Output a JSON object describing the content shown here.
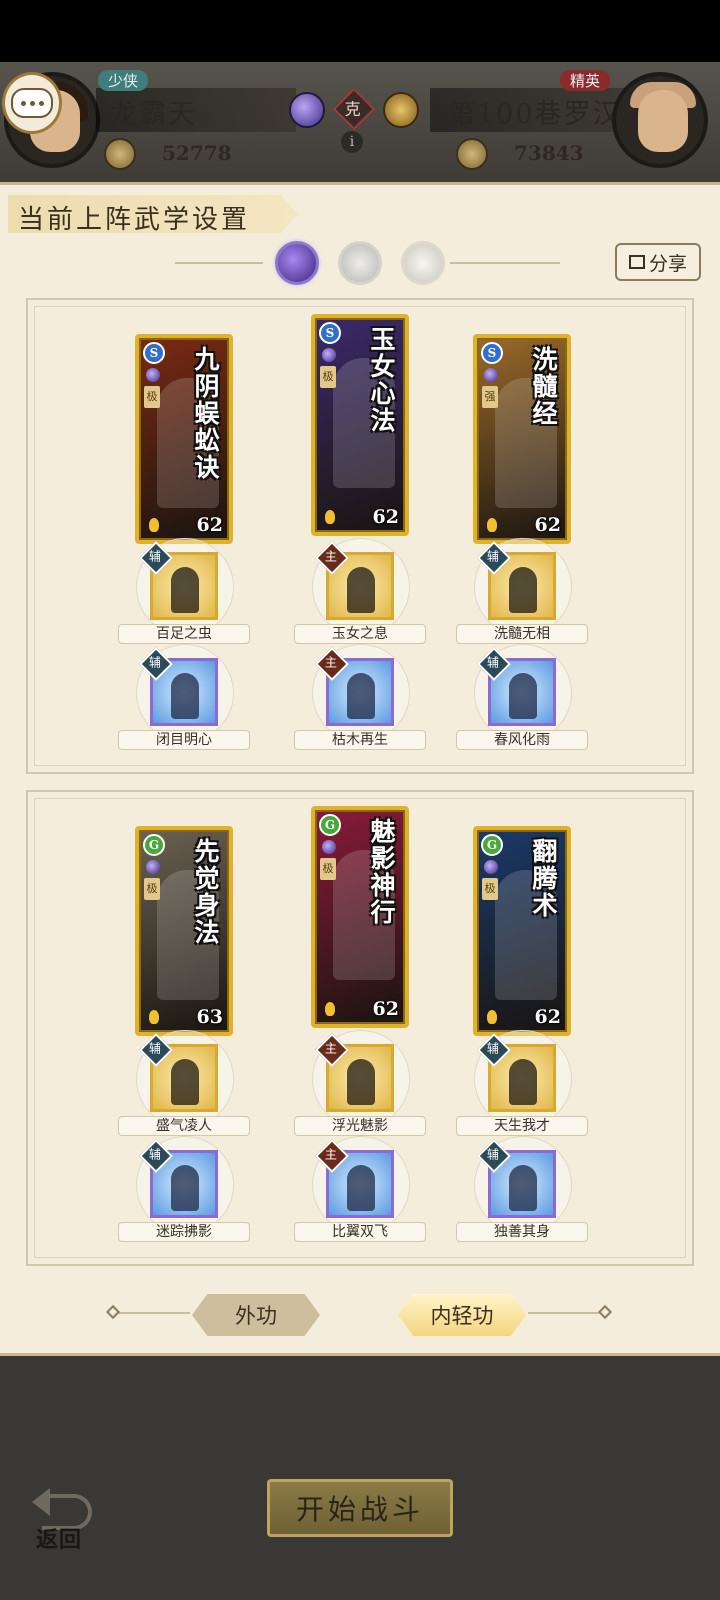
{
  "header": {
    "player": {
      "rank": "少侠",
      "name": "龙霸天",
      "power": "52778"
    },
    "opponent": {
      "rank": "精英",
      "name": "第100巷罗汉",
      "power": "73843"
    },
    "relation": "克",
    "info": "i"
  },
  "panel": {
    "title": "当前上阵武学设置",
    "share_label": "分享"
  },
  "inner_cards": [
    {
      "name": "九阴蜈蚣诀",
      "level": "62",
      "grade": "极",
      "type": "S",
      "bg": "#7a2a12"
    },
    {
      "name": "玉女心法",
      "level": "62",
      "grade": "极",
      "type": "S",
      "bg": "#3a2a6a"
    },
    {
      "name": "洗髓经",
      "level": "62",
      "grade": "强",
      "type": "S",
      "bg": "#9a6a2a"
    }
  ],
  "inner_skills_row1": [
    {
      "tag": "辅",
      "name": "百足之虫"
    },
    {
      "tag": "主",
      "name": "玉女之息"
    },
    {
      "tag": "辅",
      "name": "洗髓无相"
    }
  ],
  "inner_skills_row2": [
    {
      "tag": "辅",
      "name": "闭目明心"
    },
    {
      "tag": "主",
      "name": "枯木再生"
    },
    {
      "tag": "辅",
      "name": "春风化雨"
    }
  ],
  "qing_cards": [
    {
      "name": "先觉身法",
      "level": "63",
      "grade": "极",
      "type": "G",
      "bg": "#6a6252"
    },
    {
      "name": "魅影神行",
      "level": "62",
      "grade": "极",
      "type": "G",
      "bg": "#8a1a3a"
    },
    {
      "name": "翻腾术",
      "level": "62",
      "grade": "极",
      "type": "G",
      "bg": "#1a3a6a"
    }
  ],
  "qing_skills_row1": [
    {
      "tag": "辅",
      "name": "盛气凌人"
    },
    {
      "tag": "主",
      "name": "浮光魅影"
    },
    {
      "tag": "辅",
      "name": "天生我才"
    }
  ],
  "qing_skills_row2": [
    {
      "tag": "辅",
      "name": "迷踪拂影"
    },
    {
      "tag": "主",
      "name": "比翼双飞"
    },
    {
      "tag": "辅",
      "name": "独善其身"
    }
  ],
  "tabs": {
    "outer": "外功",
    "inner": "内轻功"
  },
  "footer": {
    "start": "开始战斗",
    "back": "返回"
  }
}
